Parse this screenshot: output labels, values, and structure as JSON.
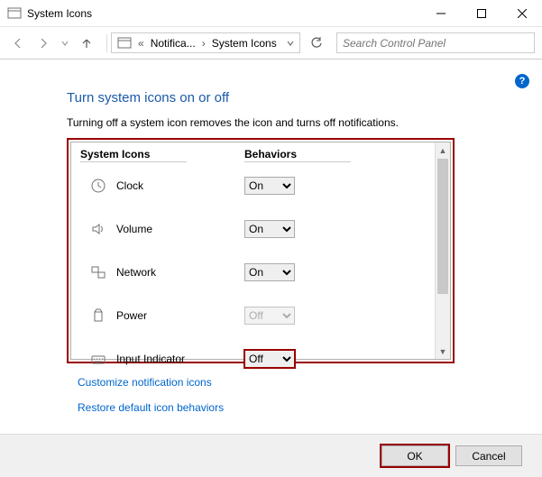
{
  "window": {
    "title": "System Icons"
  },
  "nav": {
    "breadcrumb": {
      "item1": "Notifica...",
      "item2": "System Icons"
    },
    "search_placeholder": "Search Control Panel"
  },
  "page": {
    "heading": "Turn system icons on or off",
    "subhead": "Turning off a system icon removes the icon and turns off notifications.",
    "col1": "System Icons",
    "col2": "Behaviors",
    "rows": [
      {
        "label": "Clock",
        "value": "On",
        "enabled": true,
        "icon": "clock-icon"
      },
      {
        "label": "Volume",
        "value": "On",
        "enabled": true,
        "icon": "volume-icon"
      },
      {
        "label": "Network",
        "value": "On",
        "enabled": true,
        "icon": "network-icon"
      },
      {
        "label": "Power",
        "value": "Off",
        "enabled": false,
        "icon": "power-icon"
      },
      {
        "label": "Input Indicator",
        "value": "Off",
        "enabled": true,
        "icon": "input-indicator-icon",
        "highlight": true
      }
    ],
    "options": [
      "On",
      "Off"
    ],
    "link1": "Customize notification icons",
    "link2": "Restore default icon behaviors"
  },
  "footer": {
    "ok": "OK",
    "cancel": "Cancel"
  }
}
